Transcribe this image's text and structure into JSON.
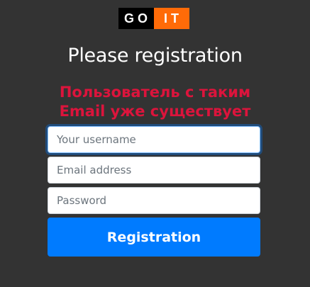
{
  "logo": {
    "left_text": "GO",
    "right_text": "IT",
    "left_color": "#000000",
    "right_color": "#ff6b08"
  },
  "page_title": "Please registration",
  "error": {
    "line1": "Пользователь с таким",
    "line2": "Email уже существует",
    "color": "#dc143c"
  },
  "form": {
    "username_placeholder": "Your username",
    "email_placeholder": "Email address",
    "password_placeholder": "Password",
    "submit_label": "Registration",
    "accent_color": "#007bff"
  }
}
